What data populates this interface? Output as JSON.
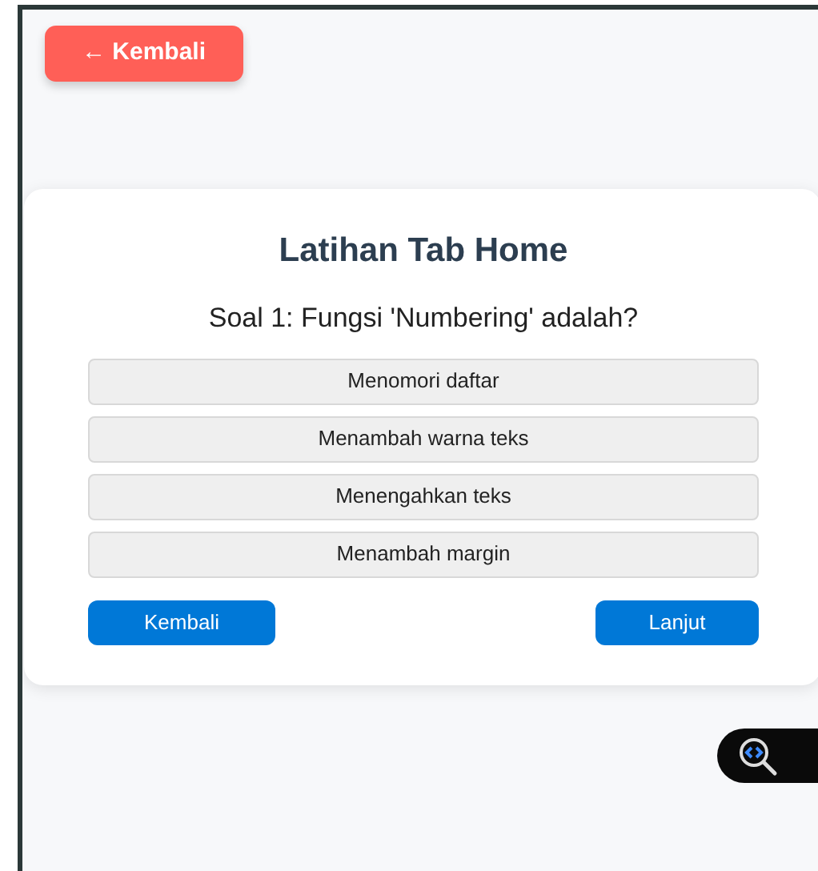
{
  "back_button": {
    "label": "← Kembali"
  },
  "quiz": {
    "title": "Latihan Tab Home",
    "question": "Soal 1: Fungsi 'Numbering' adalah?",
    "options": [
      {
        "label": "Menomori daftar"
      },
      {
        "label": "Menambah warna teks"
      },
      {
        "label": "Menengahkan teks"
      },
      {
        "label": "Menambah margin"
      }
    ],
    "nav_buttons": [
      {
        "label": "Kembali"
      },
      {
        "label": "Lanjut"
      }
    ]
  },
  "floating_tool": {
    "kind": "code-search"
  }
}
